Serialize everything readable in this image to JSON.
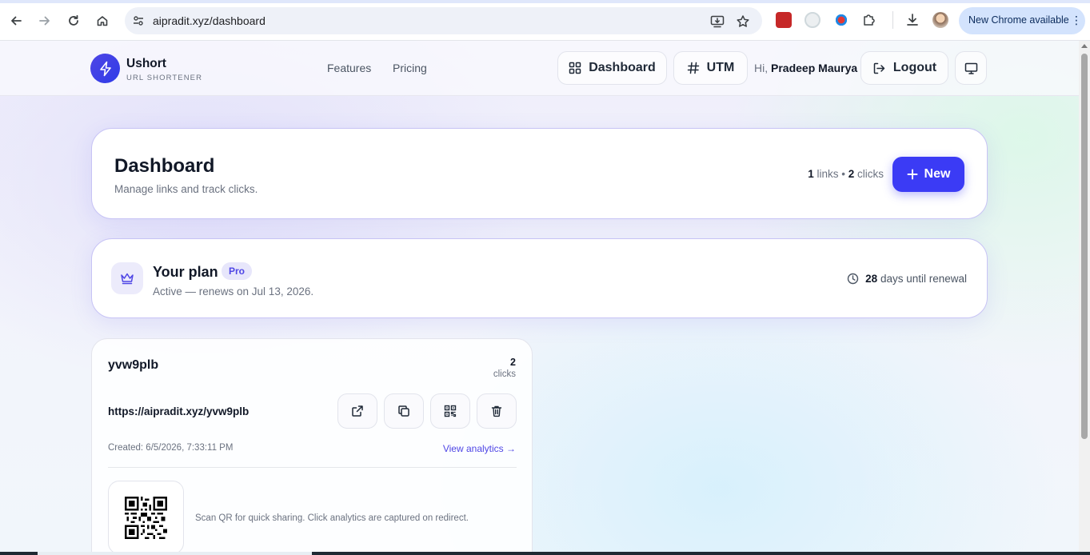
{
  "browser": {
    "url": "aipradit.xyz/dashboard",
    "update_label": "New Chrome available",
    "menu_glyph": "⋮"
  },
  "header": {
    "brand_name": "Ushort",
    "brand_tagline": "URL SHORTENER",
    "nav": {
      "features": "Features",
      "pricing": "Pricing"
    },
    "dashboard_btn": "Dashboard",
    "utm_btn": "UTM",
    "greeting": "Hi,",
    "user_name": "Pradeep Maurya",
    "logout_btn": "Logout"
  },
  "dashboard": {
    "title": "Dashboard",
    "subtitle": "Manage links and track clicks.",
    "links_count": "1",
    "links_label": "links •",
    "clicks_count": "2",
    "clicks_label": "clicks",
    "new_btn": "New"
  },
  "plan": {
    "title": "Your plan",
    "badge": "Pro",
    "status": "Active — renews on Jul 13, 2026.",
    "days": "28",
    "days_label": "days until renewal"
  },
  "links": [
    {
      "slug": "yvw9plb",
      "clicks": "2",
      "clicks_label": "clicks",
      "short_url": "https://aipradit.xyz/yvw9plb",
      "created": "Created: 6/5/2026, 7:33:11 PM",
      "analytics_link": "View analytics →",
      "qr_note": "Scan QR for quick sharing. Click analytics are captured on redirect."
    }
  ],
  "colors": {
    "accent": "#3b3bf5",
    "brand": "#4f46e5",
    "card_border": "#c7c3f5"
  }
}
